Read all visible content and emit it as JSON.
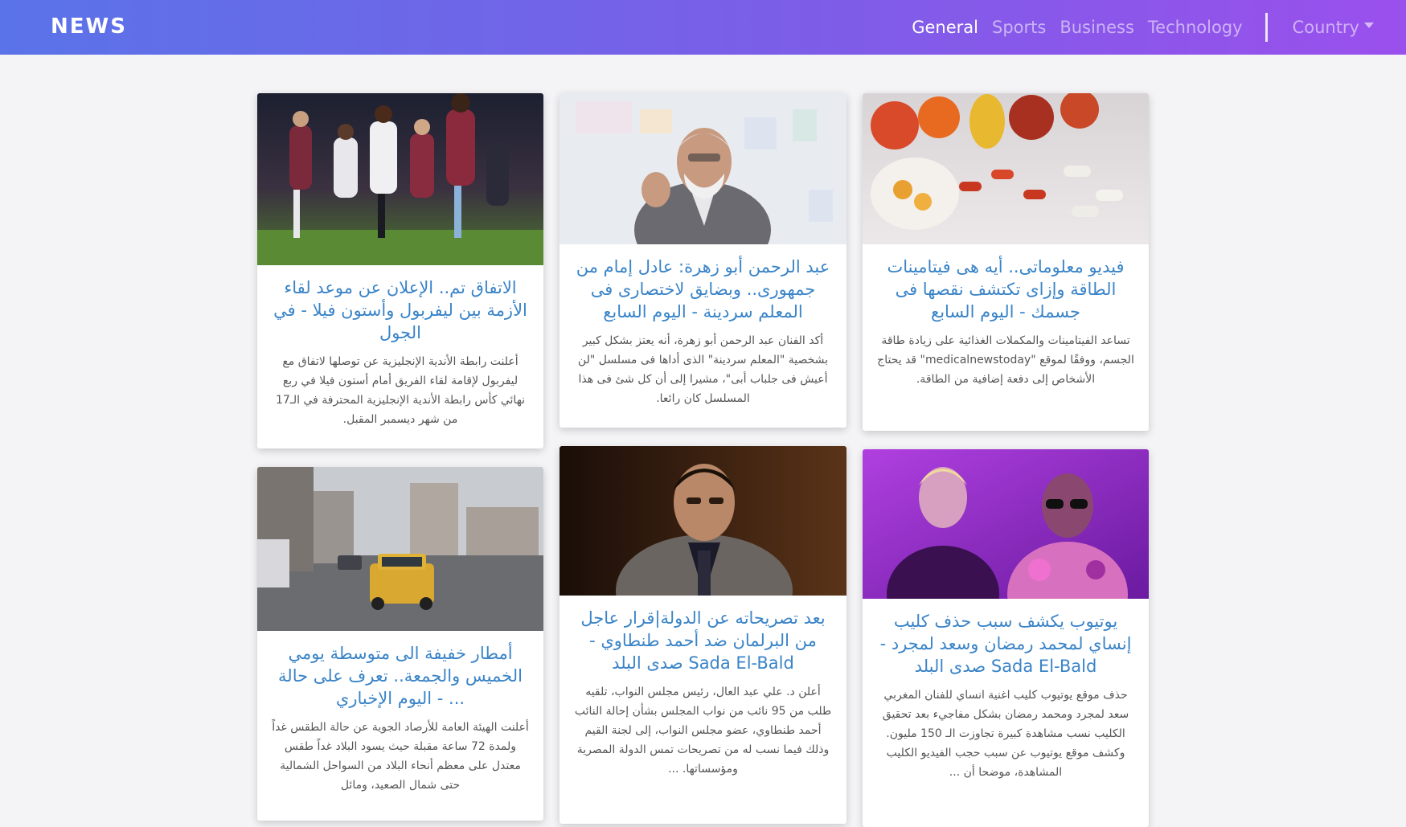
{
  "navbar": {
    "brand": "NEWS",
    "links": [
      {
        "label": "General",
        "active": true
      },
      {
        "label": "Sports",
        "active": false
      },
      {
        "label": "Business",
        "active": false
      },
      {
        "label": "Technology",
        "active": false
      }
    ],
    "country_label": "Country"
  },
  "articles": [
    {
      "title": "الاتفاق تم.. الإعلان عن موعد لقاء الأزمة بين ليفربول وأستون فيلا - في الجول",
      "description": "أعلنت رابطة الأندية الإنجليزية عن توصلها لاتفاق مع ليفربول لإقامة لقاء الفريق أمام أستون فيلا في ربع نهائي كأس رابطة الأندية الإنجليزية المحترفة في الـ17 من شهر ديسمبر المقبل."
    },
    {
      "title": "عبد الرحمن أبو زهرة: عادل إمام من جمهورى.. وبضايق لاختصارى فى المعلم سردينة - اليوم السابع",
      "description": "أكد الفنان عبد الرحمن أبو زهرة، أنه يعتز بشكل كبير بشخصية \"المعلم سردينة\" الذى أداها فى مسلسل \"لن أعيش فى جلباب أبى\"، مشيرا إلى أن كل شئ فى هذا المسلسل كان رائعا."
    },
    {
      "title": "فيديو معلوماتى.. أيه هى فيتامينات الطاقة وإزاى تكتشف نقصها فى جسمك - اليوم السابع",
      "description": "تساعد الفيتامينات والمكملات الغذائية على زيادة طاقة الجسم، ووفقًا لموقع \"medicalnewstoday\" قد يحتاج الأشخاص إلى دفعة إضافية من الطاقة."
    },
    {
      "title": "أمطار خفيفة الى متوسطة يومي الخميس والجمعة.. تعرف على حالة ... - اليوم الإخباري",
      "description": "أعلنت الهيئة العامة للأرصاد الجوية عن حالة الطقس غداً ولمدة 72 ساعة مقبلة حيث يسود البلاد غداً طقس معتدل على معظم أنحاء البلاد من السواحل الشمالية حتى شمال الصعيد، ومائل"
    },
    {
      "title": "بعد تصريحاته عن الدولة|قرار عاجل من البرلمان ضد أحمد طنطاوي - Sada El-Bald صدى البلد",
      "description": "أعلن د. علي عبد العال، رئيس مجلس النواب، تلقيه طلب من 95 نائب من نواب المجلس بشأن إحالة النائب أحمد طنطاوي، عضو مجلس النواب، إلى لجنة القيم وذلك فيما نسب له من تصريحات تمس الدولة المصرية ومؤسساتها. ..."
    },
    {
      "title": "يوتيوب يكشف سبب حذف كليب إنساي لمحمد رمضان وسعد لمجرد - Sada El-Bald صدى البلد",
      "description": "حذف موقع يوتيوب كليب اغنية انساي للفنان المغربي سعد لمجرد ومحمد رمضان بشكل مفاجيء بعد تحقيق الكليب نسب مشاهدة كبيرة تجاوزت الـ 150 مليون. وكشف موقع يوتيوب عن سبب حجب الفيديو الكليب المشاهدة، موضحا أن ..."
    }
  ]
}
